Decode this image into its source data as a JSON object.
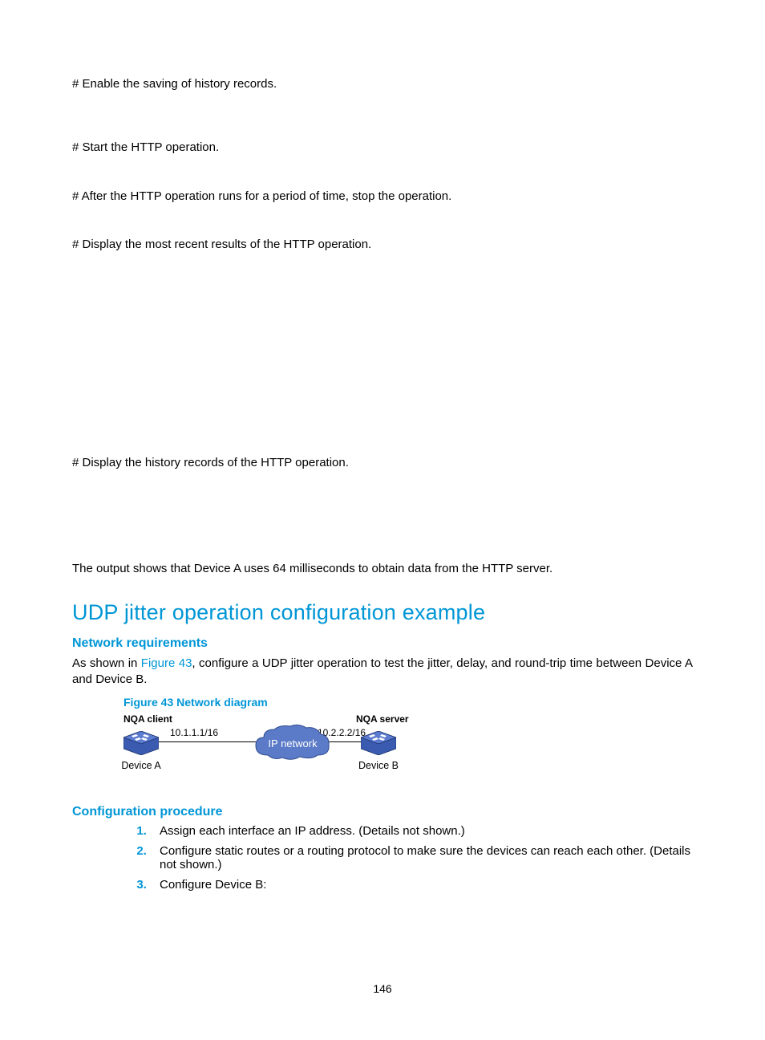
{
  "p1": "# Enable the saving of history records.",
  "p2": "# Start the HTTP operation.",
  "p3": "# After the HTTP operation runs for a period of time, stop the operation.",
  "p4": "# Display the most recent results of the HTTP operation.",
  "p5": "# Display the history records of the HTTP operation.",
  "p6": "The output shows that Device A uses 64 milliseconds to obtain data from the HTTP server.",
  "h1": "UDP jitter operation configuration example",
  "h2a": "Network requirements",
  "net_req_1": "As shown in ",
  "net_req_link": "Figure 43",
  "net_req_2": ", configure a UDP jitter operation to test the jitter, delay, and round-trip time between Device A and Device B.",
  "fig_caption": "Figure 43 Network diagram",
  "diagram": {
    "left_top": "NQA client",
    "right_top": "NQA server",
    "left_ip": "10.1.1.1/16",
    "right_ip": "10.2.2.2/16",
    "cloud": "IP network",
    "left_dev": "Device A",
    "right_dev": "Device B"
  },
  "h2b": "Configuration procedure",
  "steps": [
    "Assign each interface an IP address. (Details not shown.)",
    "Configure static routes or a routing protocol to make sure the devices can reach each other. (Details not shown.)",
    "Configure Device B:"
  ],
  "page_number": "146"
}
